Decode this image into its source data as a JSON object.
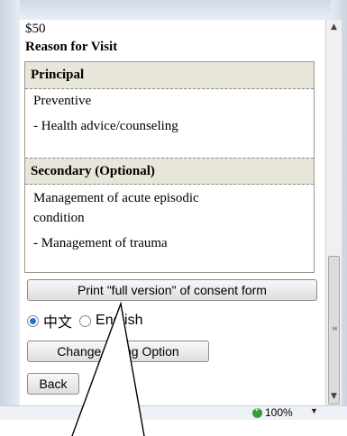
{
  "content": {
    "amount": "$50",
    "reason_title": "Reason for Visit",
    "principal": {
      "header": "Principal",
      "lines": [
        "Preventive",
        "- Health advice/counseling"
      ]
    },
    "secondary": {
      "header": "Secondary (Optional)",
      "lines": [
        "Management of acute episodic",
        "condition",
        "- Management of trauma"
      ]
    },
    "print_button": "Print \"full version\" of consent form",
    "language": {
      "option1": "中文",
      "option2": "English",
      "selected": "中文"
    },
    "change_button": "Change Billing Option",
    "back_button": "Back"
  },
  "statusbar": {
    "zoom": "100%"
  }
}
